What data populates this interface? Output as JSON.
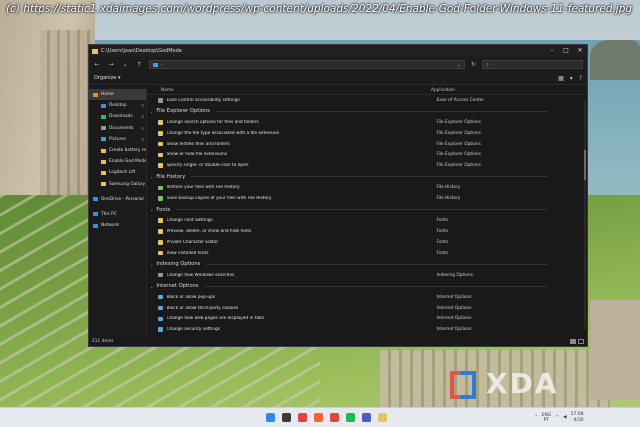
{
  "watermark_url": "(c) https://static1.xdaimages.com/wordpress/wp-content/uploads/2022/04/Enable-God-Folder-Windows-11-featured.jpg",
  "brand_logo": "XDA",
  "window": {
    "title": "C:\\Users\\joao\\Desktop\\GodMode",
    "address_text": "",
    "search_placeholder": ""
  },
  "toolbar": {
    "organize_label": "Organize ▾"
  },
  "columns": {
    "name": "Name",
    "application": "Application"
  },
  "navigation": [
    {
      "label": "Home",
      "icon": "home-icon",
      "color": "#e08a3c",
      "indent": false,
      "selected": true,
      "pinned": false
    },
    {
      "label": "Desktop",
      "icon": "desktop-icon",
      "color": "#3a8de0",
      "indent": true,
      "selected": false,
      "pinned": true
    },
    {
      "label": "Downloads",
      "icon": "download-icon",
      "color": "#3ab56e",
      "indent": true,
      "selected": false,
      "pinned": true
    },
    {
      "label": "Documents",
      "icon": "document-icon",
      "color": "#8f9aa8",
      "indent": true,
      "selected": false,
      "pinned": true
    },
    {
      "label": "Pictures",
      "icon": "picture-icon",
      "color": "#3aa0d8",
      "indent": true,
      "selected": false,
      "pinned": true
    },
    {
      "label": "Create battery repo",
      "icon": "folder-icon",
      "color": "#e8c25e",
      "indent": true,
      "selected": false,
      "pinned": false
    },
    {
      "label": "Enable God Mode",
      "icon": "folder-icon",
      "color": "#e8c25e",
      "indent": true,
      "selected": false,
      "pinned": false
    },
    {
      "label": "Logitech Lift",
      "icon": "folder-icon",
      "color": "#e8c25e",
      "indent": true,
      "selected": false,
      "pinned": false
    },
    {
      "label": "Samsung Galaxy C",
      "icon": "folder-icon",
      "color": "#e8c25e",
      "indent": true,
      "selected": false,
      "pinned": false
    },
    {
      "label": "OneDrive - Personal",
      "icon": "cloud-icon",
      "color": "#3a8de0",
      "indent": false,
      "selected": false,
      "pinned": false,
      "gap_before": true
    },
    {
      "label": "This PC",
      "icon": "computer-icon",
      "color": "#3a8de0",
      "indent": false,
      "selected": false,
      "pinned": false,
      "gap_before": true
    },
    {
      "label": "Network",
      "icon": "network-icon",
      "color": "#3a8de0",
      "indent": false,
      "selected": false,
      "pinned": false
    }
  ],
  "items": [
    {
      "type": "row",
      "name": "Ease Control accessibility settings",
      "app": "Ease of Access Center",
      "color": "#8a9aa8"
    },
    {
      "type": "group",
      "name": "File Explorer Options"
    },
    {
      "type": "row",
      "name": "Change search options for files and folders",
      "app": "File Explorer Options",
      "color": "#e8c25e"
    },
    {
      "type": "row",
      "name": "Change the file type associated with a file extension",
      "app": "File Explorer Options",
      "color": "#e8c25e"
    },
    {
      "type": "row",
      "name": "Show hidden files and folders",
      "app": "File Explorer Options",
      "color": "#e8c25e"
    },
    {
      "type": "row",
      "name": "Show or hide file extensions",
      "app": "File Explorer Options",
      "color": "#e8c25e"
    },
    {
      "type": "row",
      "name": "Specify single- or double-click to open",
      "app": "File Explorer Options",
      "color": "#e8c25e"
    },
    {
      "type": "group",
      "name": "File History"
    },
    {
      "type": "row",
      "name": "Restore your files with File History",
      "app": "File History",
      "color": "#7cc26b"
    },
    {
      "type": "row",
      "name": "Save backup copies of your files with File History",
      "app": "File History",
      "color": "#7cc26b"
    },
    {
      "type": "group",
      "name": "Fonts"
    },
    {
      "type": "row",
      "name": "Change Font Settings",
      "app": "Fonts",
      "color": "#e8c25e"
    },
    {
      "type": "row",
      "name": "Preview, delete, or show and hide fonts",
      "app": "Fonts",
      "color": "#e8c25e"
    },
    {
      "type": "row",
      "name": "Private Character Editor",
      "app": "Fonts",
      "color": "#e8c25e"
    },
    {
      "type": "row",
      "name": "View installed fonts",
      "app": "Fonts",
      "color": "#e8c25e"
    },
    {
      "type": "group",
      "name": "Indexing Options"
    },
    {
      "type": "row",
      "name": "Change how Windows searches",
      "app": "Indexing Options",
      "color": "#8a9aa8"
    },
    {
      "type": "group",
      "name": "Internet Options"
    },
    {
      "type": "row",
      "name": "Block or allow pop-ups",
      "app": "Internet Options",
      "color": "#5aa8e0"
    },
    {
      "type": "row",
      "name": "Block or allow third-party cookies",
      "app": "Internet Options",
      "color": "#5aa8e0"
    },
    {
      "type": "row",
      "name": "Change how web pages are displayed in tabs",
      "app": "Internet Options",
      "color": "#5aa8e0"
    },
    {
      "type": "row",
      "name": "Change security settings",
      "app": "Internet Options",
      "color": "#5aa8e0"
    },
    {
      "type": "row",
      "name": "Change temporary Internet file settings",
      "app": "Internet Options",
      "color": "#5aa8e0"
    }
  ],
  "status": {
    "count": "211 items"
  },
  "taskbar": {
    "icons": [
      {
        "name": "start-icon",
        "color": "#2d89ef"
      },
      {
        "name": "search-icon",
        "color": "#3a3a3a"
      },
      {
        "name": "vivaldi-icon",
        "color": "#e0453a"
      },
      {
        "name": "brave-icon",
        "color": "#f0672c"
      },
      {
        "name": "store-icon",
        "color": "#e0453a"
      },
      {
        "name": "spotify-icon",
        "color": "#1db954"
      },
      {
        "name": "teams-icon",
        "color": "#4b5cc4"
      },
      {
        "name": "explorer-icon",
        "color": "#e8c25e"
      }
    ],
    "lang_top": "ENG",
    "lang_bottom": "PT",
    "time": "17:08",
    "date": "4/30"
  }
}
